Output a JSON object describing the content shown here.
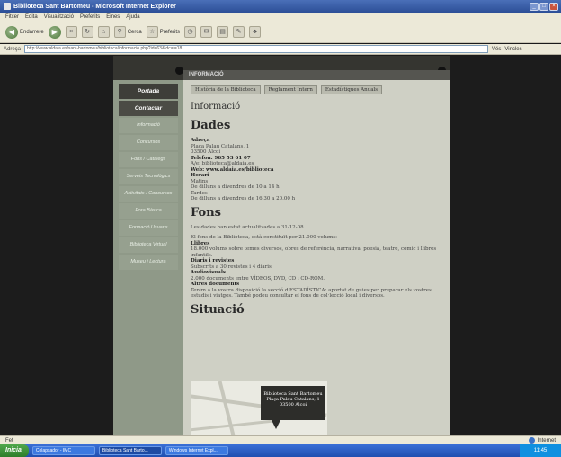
{
  "window": {
    "title": "Biblioteca Sant Bartomeu - Microsoft Internet Explorer",
    "buttons": [
      "_",
      "□",
      "×"
    ]
  },
  "menu": [
    "Fitxer",
    "Edita",
    "Visualització",
    "Preferits",
    "Eines",
    "Ajuda"
  ],
  "toolbar": {
    "back": "Endarrere",
    "search": "Cerca",
    "favorites": "Preferits"
  },
  "address": {
    "label": "Adreça",
    "url": "http://www.aldaia.es/sant-bartomeu/biblioteca/informacio.php?id=63&idcat=18",
    "go": "Vés",
    "links": "Vincles"
  },
  "site": {
    "header_bar": "INFORMACIÓ",
    "sidebar": [
      "Portada",
      "Contactar",
      "Informació",
      "Concursos",
      "Fons / Catàlegs",
      "Serveis Tecnològics",
      "Activitats / Concursos",
      "Fora Bàsica",
      "Formació Usuaris",
      "Biblioteca Virtual",
      "Museu i Lectura"
    ],
    "tabs": [
      "Història de la Biblioteca",
      "Reglament Intern",
      "Estadístiques Anuals"
    ],
    "page_heading": "Informació",
    "dades": {
      "title": "Dades",
      "lines": [
        {
          "bold": true,
          "text": "Adreça"
        },
        {
          "bold": false,
          "text": "Plaça Palau Catalans, 1"
        },
        {
          "bold": false,
          "text": "03500 Alcoi"
        },
        {
          "bold": true,
          "text": "Telèfon: 965 53 61 07"
        },
        {
          "bold": false,
          "text": "A/e: biblioteca@aldaia.es"
        },
        {
          "bold": true,
          "text": "Web: www.aldaia.es/biblioteca"
        },
        {
          "bold": true,
          "text": "Horari"
        },
        {
          "bold": false,
          "text": "Matins"
        },
        {
          "bold": false,
          "text": "De dilluns a divendres de 10 a 14 h"
        },
        {
          "bold": false,
          "text": "Tardes"
        },
        {
          "bold": false,
          "text": "De dilluns a divendres de 16.30 a 20.00 h"
        }
      ]
    },
    "fons": {
      "title": "Fons",
      "intro": "Les dades han estat actualitzades a 31-12-08.",
      "intro2": "El fons de la Biblioteca, està constituït per 21.000 volums:",
      "lines": [
        {
          "bold": true,
          "text": "Llibres"
        },
        {
          "bold": false,
          "text": "18.000 volums sobre temes diversos, obres de referència, narrativa, poesia, teatre, còmic i llibres infantils."
        },
        {
          "bold": true,
          "text": "Diaris i revistes"
        },
        {
          "bold": false,
          "text": "Subscrits a 30 revistes i 4 diaris."
        },
        {
          "bold": true,
          "text": "Audiovisuals"
        },
        {
          "bold": false,
          "text": "2.000 documents entre VÍDEOS, DVD, CD i CD-ROM."
        },
        {
          "bold": true,
          "text": "Altres documents"
        },
        {
          "bold": false,
          "text": "Tenim a la vostra disposició la secció d'ESTADÍSTICA: aportat de guies per preparar els vostres estudis i viatges. També podeu consultar el fons de col·lecció local i diversos."
        }
      ]
    },
    "situacio": {
      "title": "Situació",
      "map_callout": [
        "Biblioteca Sant Bartomeu",
        "Plaça Palau Catalans, 1",
        "03500 Alcoi"
      ]
    }
  },
  "status": {
    "left": "Fet",
    "zone": "Internet"
  },
  "taskbar": {
    "start": "Inicia",
    "tasks": [
      "Colapsador - IMC",
      "Biblioteca Sant Barto...",
      "Windows Internet Expl..."
    ],
    "tray": "11:45"
  }
}
